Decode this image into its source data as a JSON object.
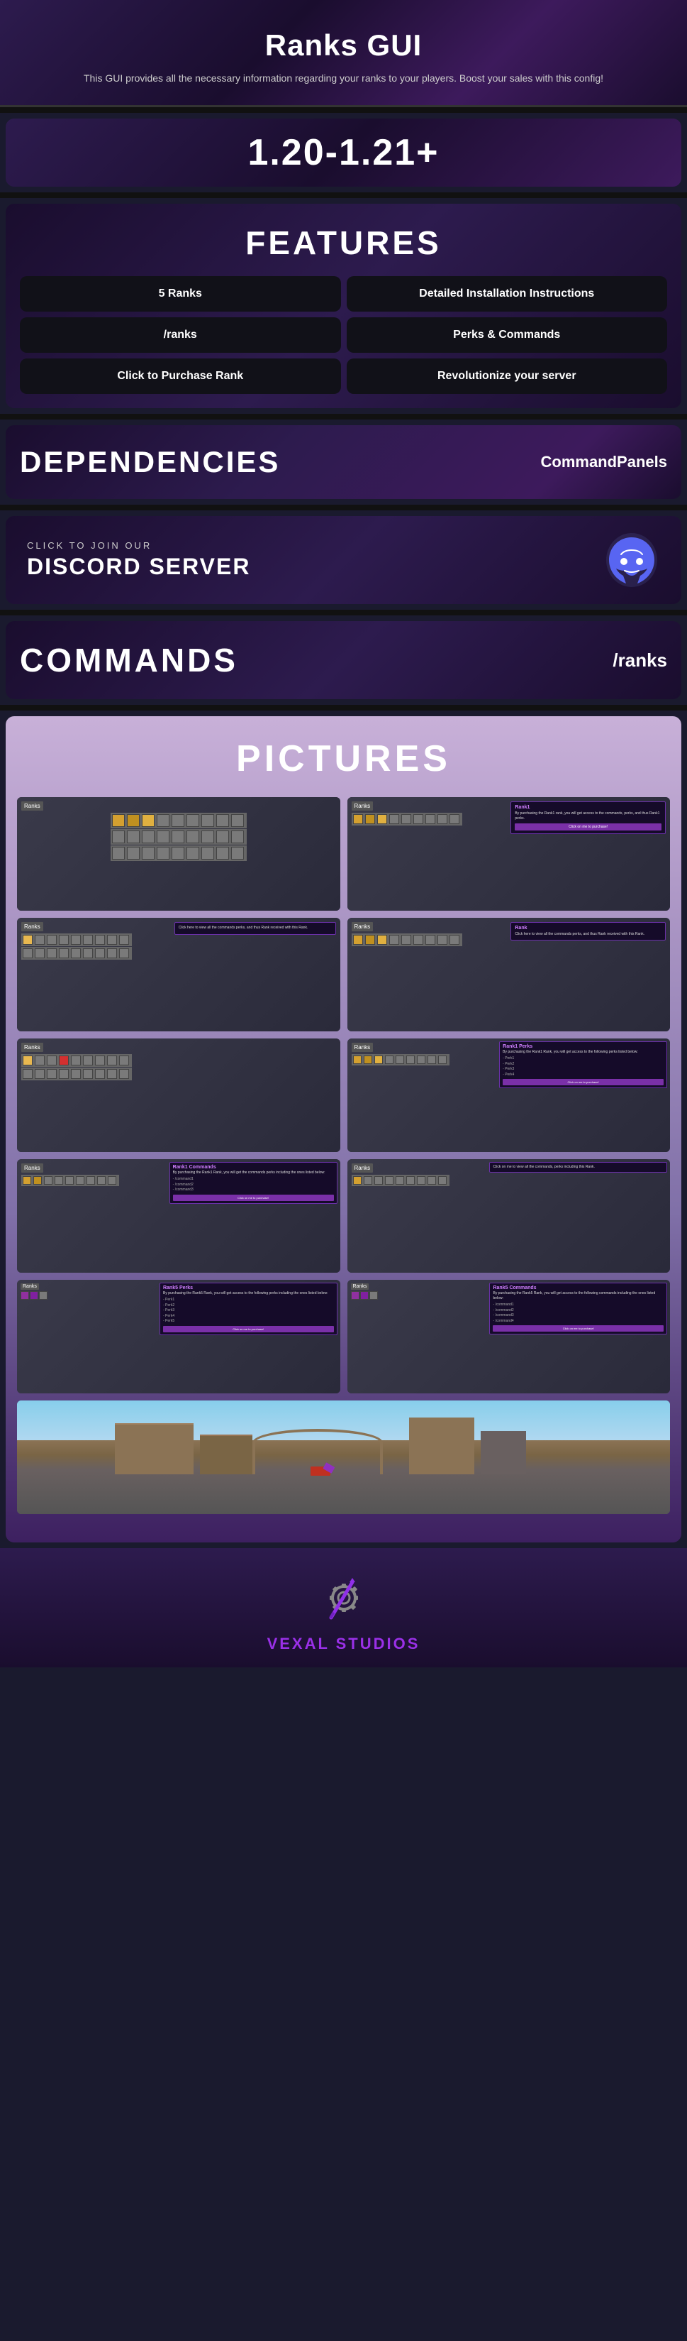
{
  "header": {
    "title": "Ranks GUI",
    "subtitle": "This GUI provides all the necessary information regarding your ranks to your players. Boost your sales with this config!"
  },
  "version": {
    "text": "1.20-1.21+"
  },
  "features": {
    "title": "FEATURES",
    "items": [
      {
        "label": "5 Ranks"
      },
      {
        "label": "Detailed Installation Instructions"
      },
      {
        "label": "/ranks"
      },
      {
        "label": "Perks & Commands"
      },
      {
        "label": "Click to Purchase Rank"
      },
      {
        "label": "Revolutionize your server"
      }
    ]
  },
  "dependencies": {
    "title": "DEPENDENCIES",
    "value": "CommandPanels"
  },
  "discord": {
    "small_text": "CLICK TO JOIN OUR",
    "big_text": "DISCORD SERVER"
  },
  "commands": {
    "title": "COMMANDS",
    "value": "/ranks"
  },
  "pictures": {
    "title": "PICTURES"
  },
  "footer": {
    "brand": "VEXAL STUDIOS"
  }
}
